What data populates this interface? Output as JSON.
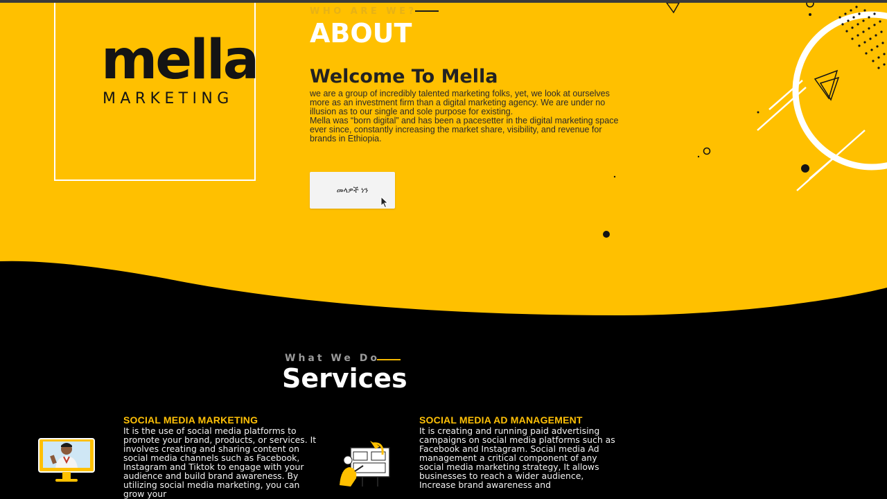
{
  "about": {
    "logo": {
      "word": "mella",
      "sub": "MARKETING"
    },
    "eyebrow": "WHO ARE WE?",
    "title": "ABOUT",
    "welcome": "Welcome To Mella",
    "paragraph_1": "we are a group of incredibly talented marketing folks, yet, we look at ourselves more as an investment firm than a digital marketing agency. We are under no illusion as to our single and sole purpose for existing.",
    "paragraph_2": "Mella was “born digital” and has been a pacesetter in the digital marketing space ever since, constantly increasing the market share, visibility, and revenue for brands in Ethiopia.",
    "cta_label": "መላዎች ነን"
  },
  "services": {
    "eyebrow": "What We Do",
    "title": "Services",
    "cards": [
      {
        "heading": "SOCIAL MEDIA MARKETING",
        "text": "It is the use of social media platforms to promote your brand, products, or services. It involves creating and sharing content on social media channels such as Facebook, Instagram and Tiktok to engage with your audience and build brand awareness. By utilizing social media marketing, you can grow your",
        "icon": "monitor-person-icon"
      },
      {
        "heading": "SOCIAL MEDIA AD MANAGEMENT",
        "text": "It is creating and running paid advertising campaigns on social media platforms such as Facebook and Instagram. Social media Ad management a critical component of any social media marketing strategy, It allows businesses to reach a wider audience, Increase brand awareness and",
        "icon": "ad-presentation-icon"
      }
    ]
  },
  "colors": {
    "brand_yellow": "#ffc000",
    "dark": "#000000",
    "heading_yellow": "#ffc107",
    "white": "#ffffff"
  }
}
